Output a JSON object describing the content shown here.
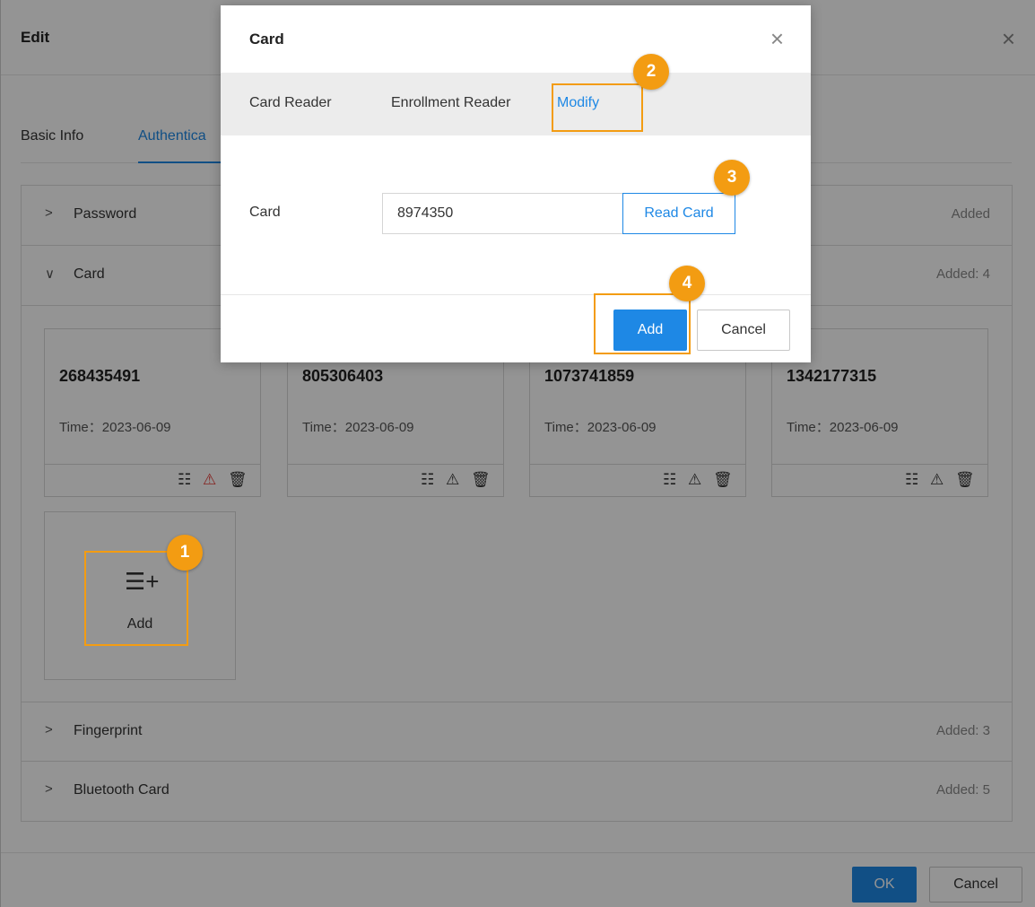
{
  "edit_dialog": {
    "title": "Edit",
    "close_glyph": "×",
    "tabs": [
      {
        "label": "Basic Info",
        "active": false
      },
      {
        "label": "Authentica",
        "active": true
      }
    ],
    "sections": [
      {
        "label": "Password",
        "chevron": ">",
        "status": "Added"
      },
      {
        "label": "Card",
        "chevron": "∨",
        "status": "Added: 4"
      },
      {
        "label": "Fingerprint",
        "chevron": ">",
        "status": "Added: 3"
      },
      {
        "label": "Bluetooth Card",
        "chevron": ">",
        "status": "Added: 5"
      }
    ],
    "cards": [
      {
        "number": "268435491",
        "time": "Time：2023-06-09",
        "alarm_active": true
      },
      {
        "number": "805306403",
        "time": "Time：2023-06-09",
        "alarm_active": false
      },
      {
        "number": "1073741859",
        "time": "Time：2023-06-09",
        "alarm_active": false
      },
      {
        "number": "1342177315",
        "time": "Time：2023-06-09",
        "alarm_active": false
      }
    ],
    "card_action_glyphs": {
      "edit": "☷",
      "alarm": "⚠",
      "delete": "🗑"
    },
    "add_tile": {
      "icon_glyph": "☰+",
      "label": "Add"
    },
    "ok_label": "OK",
    "cancel_label": "Cancel"
  },
  "card_modal": {
    "title": "Card",
    "close_glyph": "×",
    "tabs": [
      {
        "label": "Card Reader",
        "active": false
      },
      {
        "label": "Enrollment Reader",
        "active": false
      },
      {
        "label": "Modify",
        "active": true
      }
    ],
    "field_label": "Card",
    "card_value": "8974350",
    "read_card_label": "Read Card",
    "add_label": "Add",
    "cancel_label": "Cancel"
  },
  "callouts": [
    "1",
    "2",
    "3",
    "4"
  ],
  "colors": {
    "accent": "#1e88e5",
    "callout": "#f39c12",
    "alarm": "#e53935"
  }
}
